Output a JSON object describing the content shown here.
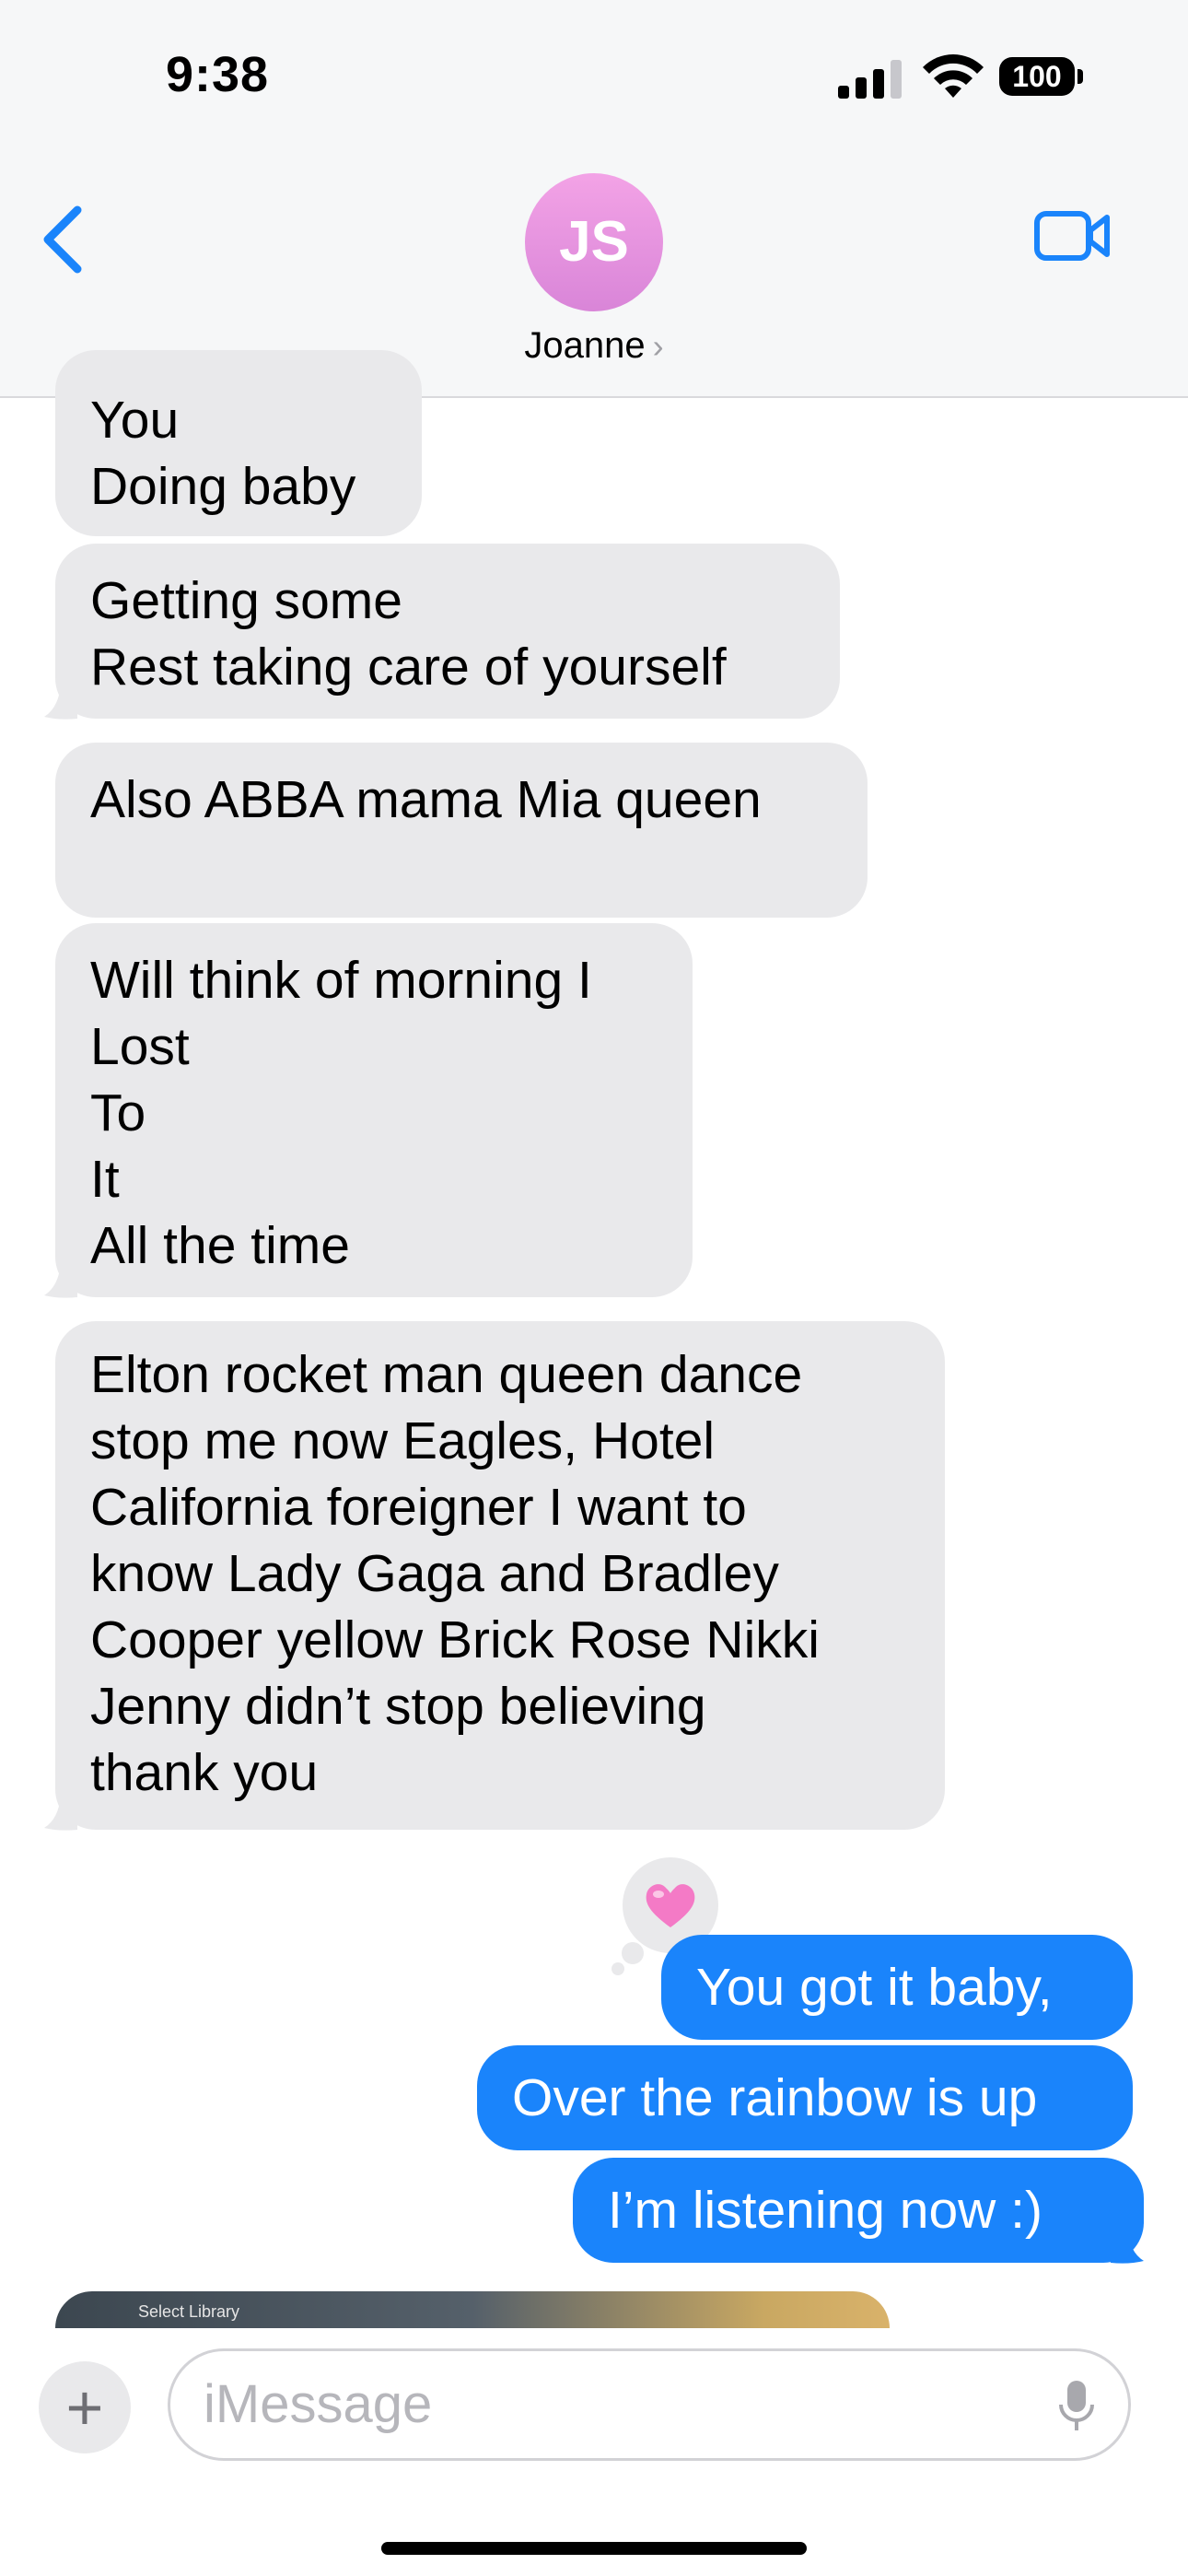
{
  "status_bar": {
    "time": "9:38",
    "battery": "100"
  },
  "header": {
    "avatar_initials": "JS",
    "contact_name": "Joanne",
    "chevron": "›"
  },
  "messages": {
    "m1": "You\nDoing baby",
    "m2": "Getting some\nRest taking care of yourself",
    "m3": "Also ABBA mama Mia queen",
    "m4": "Will think of morning I\nLost\nTo\nIt\nAll the time",
    "m5": "Elton rocket man queen dance\nstop me now Eagles, Hotel\nCalifornia foreigner I want to\nknow Lady Gaga and Bradley\nCooper yellow Brick Rose Nikki\nJenny didn’t stop believing\nthank you",
    "s1": "You got it baby,",
    "s2": "Over the rainbow is up",
    "s3": "I’m listening now :)"
  },
  "reaction": {
    "type": "heart"
  },
  "media_preview": {
    "visible_text": "Select Library"
  },
  "composer": {
    "plus_label": "+",
    "placeholder": "iMessage"
  },
  "colors": {
    "sent_bubble": "#1a84fb",
    "received_bubble": "#e9e9eb",
    "accent": "#1a84fb"
  }
}
